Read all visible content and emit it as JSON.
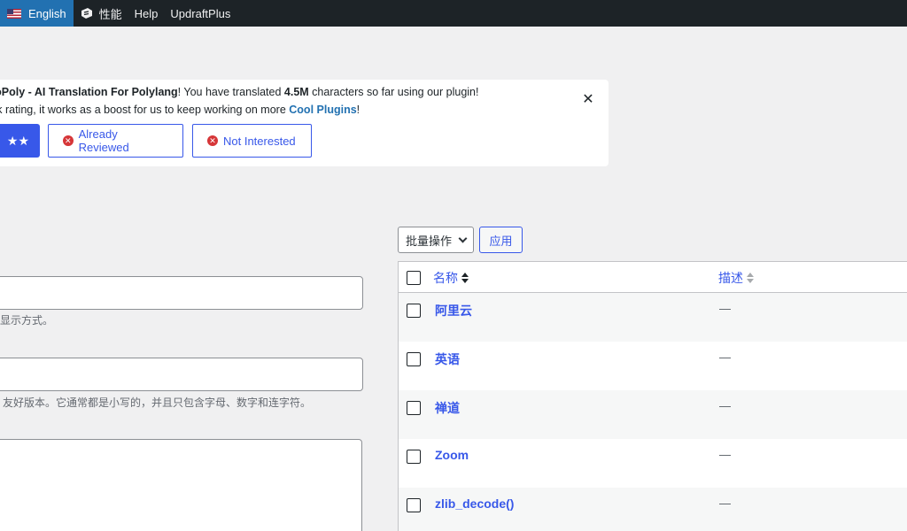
{
  "adminbar": {
    "language": "English",
    "performance": "性能",
    "help": "Help",
    "updraft": "UpdraftPlus"
  },
  "notice": {
    "line1_plugin": "toPoly - AI Translation For Polylang",
    "line1_mid": "! You have translated ",
    "line1_count": "4.5M",
    "line1_end": " characters so far using our plugin!",
    "line2_start": "ck rating, it works as a boost for us to keep working on more ",
    "line2_link": "Cool Plugins",
    "line2_end": "!",
    "rate_stars": "★★",
    "already_reviewed": "Already Reviewed",
    "not_interested": "Not Interested",
    "close": "✕"
  },
  "form": {
    "desc1": "显示方式。",
    "desc2": "友好版本。它通常都是小写的，并且只包含字母、数字和连字符。"
  },
  "bulk": {
    "select_value": "批量操作",
    "apply": "应用"
  },
  "table": {
    "col_name": "名称",
    "col_desc": "描述",
    "rows": [
      {
        "name": "阿里云",
        "desc": "—"
      },
      {
        "name": "英语",
        "desc": "—"
      },
      {
        "name": "禅道",
        "desc": "—"
      },
      {
        "name": "Zoom",
        "desc": "—"
      },
      {
        "name": "zlib_decode()",
        "desc": "—"
      }
    ]
  },
  "colors": {
    "adminbar_bg": "#1d2327",
    "active_bg": "#2271b1",
    "link": "#3858e9",
    "danger": "#d63638"
  }
}
